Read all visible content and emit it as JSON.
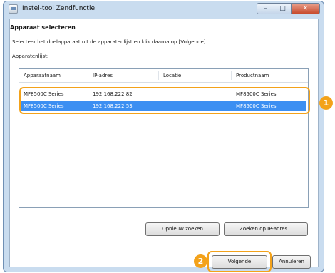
{
  "window": {
    "title": "Instel-tool Zendfunctie",
    "controls": {
      "minimize": "–",
      "maximize": "□",
      "close": "✕"
    }
  },
  "main": {
    "heading": "Apparaat selecteren",
    "instruction": "Selecteer het doelapparaat uit de apparatenlijst en klik daarna op [Volgende].",
    "list_label": "Apparatenlijst:",
    "columns": [
      "Apparaatnaam",
      "IP-adres",
      "Locatie",
      "Productnaam"
    ],
    "rows": [
      {
        "name": "MF8500C Series",
        "ip": "192.168.222.82",
        "location": "",
        "product": "MF8500C Series"
      },
      {
        "name": "MF8500C Series",
        "ip": "192.168.222.53",
        "location": "",
        "product": "MF8500C Series"
      }
    ],
    "selected_row": 2
  },
  "buttons": {
    "search_again": "Opnieuw zoeken",
    "search_ip": "Zoeken op IP-adres...",
    "next": "Volgende",
    "cancel": "Annuleren"
  },
  "callouts": {
    "one": "1",
    "two": "2"
  },
  "colors": {
    "highlight": "#f3a21a",
    "selection": "#3c8ff2"
  }
}
